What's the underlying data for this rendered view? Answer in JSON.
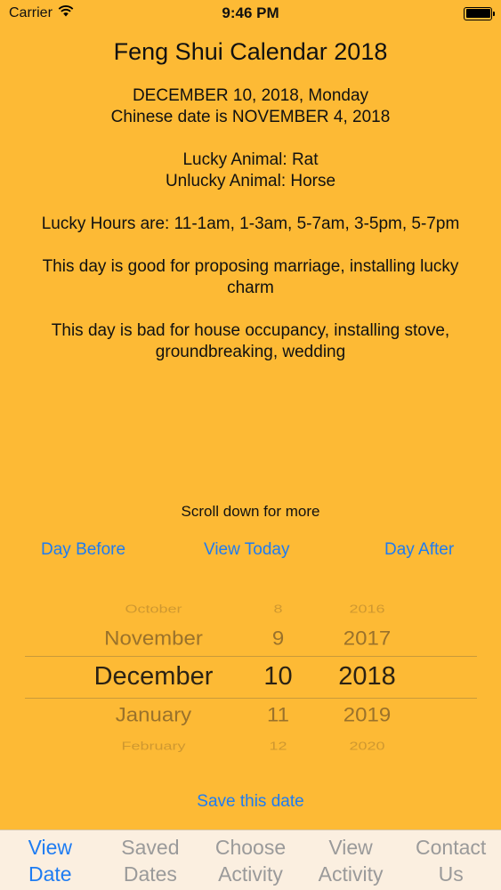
{
  "status_bar": {
    "carrier": "Carrier",
    "time": "9:46 PM",
    "wifi_icon": "wifi-icon",
    "battery_icon": "battery-icon"
  },
  "header": {
    "title": "Feng Shui Calendar 2018"
  },
  "info": {
    "date_line": "DECEMBER 10, 2018, Monday",
    "chinese_date_line": "Chinese date is NOVEMBER 4, 2018",
    "lucky_animal": "Lucky Animal: Rat",
    "unlucky_animal": "Unlucky Animal: Horse",
    "lucky_hours": "Lucky Hours are: 11-1am, 1-3am, 5-7am, 3-5pm, 5-7pm",
    "good_for": "This day is good for proposing marriage, installing lucky charm",
    "bad_for": "This day is bad for house occupancy, installing stove, groundbreaking, wedding"
  },
  "scroll_hint": "Scroll down for more",
  "nav": {
    "day_before": "Day Before",
    "view_today": "View Today",
    "day_after": "Day After"
  },
  "picker": {
    "months": [
      "October",
      "November",
      "December",
      "January",
      "February"
    ],
    "days": [
      "8",
      "9",
      "10",
      "11",
      "12"
    ],
    "years": [
      "2016",
      "2017",
      "2018",
      "2019",
      "2020"
    ],
    "selected": {
      "month": "December",
      "day": "10",
      "year": "2018"
    }
  },
  "save_label": "Save this date",
  "tabs": [
    {
      "label_line1": "View",
      "label_line2": "Date",
      "active": true
    },
    {
      "label_line1": "Saved",
      "label_line2": "Dates",
      "active": false
    },
    {
      "label_line1": "Choose",
      "label_line2": "Activity",
      "active": false
    },
    {
      "label_line1": "View",
      "label_line2": "Activity",
      "active": false
    },
    {
      "label_line1": "Contact",
      "label_line2": "Us",
      "active": false
    }
  ],
  "colors": {
    "background": "#FDBA35",
    "accent": "#1E7CF2",
    "tab_bar_bg": "#FBEFE0",
    "tab_inactive": "#9A9A9A"
  }
}
